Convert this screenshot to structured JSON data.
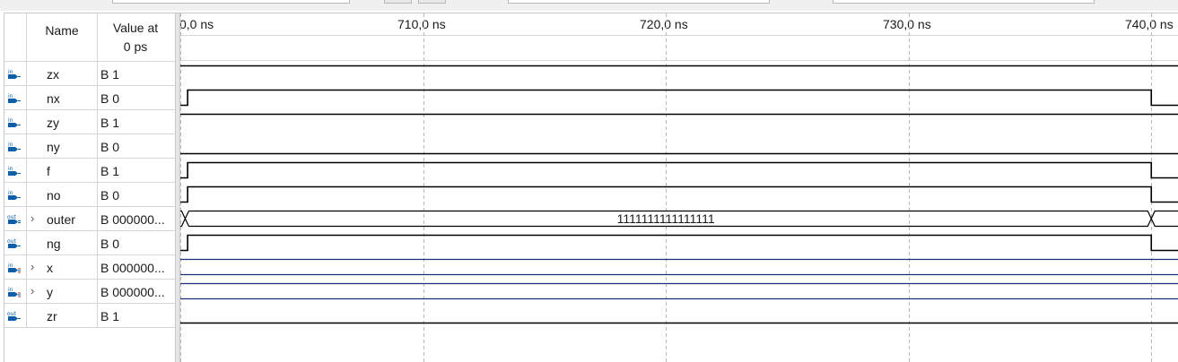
{
  "header": {
    "name_label": "Name",
    "value_label_line1": "Value at",
    "value_label_line2": "0 ps"
  },
  "signals": [
    {
      "name": "zx",
      "direction": "in",
      "value": "B 1",
      "expandable": false,
      "pin_icon": "input-pin-icon"
    },
    {
      "name": "nx",
      "direction": "in",
      "value": "B 0",
      "expandable": false,
      "pin_icon": "input-pin-icon"
    },
    {
      "name": "zy",
      "direction": "in",
      "value": "B 1",
      "expandable": false,
      "pin_icon": "input-pin-icon"
    },
    {
      "name": "ny",
      "direction": "in",
      "value": "B 0",
      "expandable": false,
      "pin_icon": "input-pin-icon"
    },
    {
      "name": "f",
      "direction": "in",
      "value": "B 1",
      "expandable": false,
      "pin_icon": "input-pin-icon"
    },
    {
      "name": "no",
      "direction": "in",
      "value": "B 0",
      "expandable": false,
      "pin_icon": "input-pin-icon"
    },
    {
      "name": "outer",
      "direction": "out",
      "value": "B 000000...",
      "expandable": true,
      "pin_icon": "output-bus-icon"
    },
    {
      "name": "ng",
      "direction": "out",
      "value": "B 0",
      "expandable": false,
      "pin_icon": "output-pin-icon"
    },
    {
      "name": "x",
      "direction": "in",
      "value": "B 000000...",
      "expandable": true,
      "pin_icon": "input-bus-icon"
    },
    {
      "name": "y",
      "direction": "in",
      "value": "B 000000...",
      "expandable": true,
      "pin_icon": "input-bus-icon"
    },
    {
      "name": "zr",
      "direction": "out",
      "value": "B 1",
      "expandable": false,
      "pin_icon": "output-pin-icon"
    }
  ],
  "timeline": {
    "ticks": [
      "0,0 ns",
      "710,0 ns",
      "720,0 ns",
      "730,0 ns",
      "740,0 ns"
    ],
    "tick_times_ns": [
      700,
      710,
      720,
      730,
      740
    ],
    "visible_start_ns": 700,
    "visible_end_ns": 741.1
  },
  "waveforms": [
    {
      "signal": "zx",
      "type": "bit",
      "segments": [
        {
          "from": 700,
          "to": 741.1,
          "level": 1
        }
      ]
    },
    {
      "signal": "nx",
      "type": "bit",
      "segments": [
        {
          "from": 700,
          "to": 700.3,
          "level": 0
        },
        {
          "from": 700.3,
          "to": 740,
          "level": 1
        },
        {
          "from": 740,
          "to": 741.1,
          "level": 0
        }
      ]
    },
    {
      "signal": "zy",
      "type": "bit",
      "segments": [
        {
          "from": 700,
          "to": 741.1,
          "level": 1
        }
      ]
    },
    {
      "signal": "ny",
      "type": "bit",
      "segments": [
        {
          "from": 700,
          "to": 741.1,
          "level": 0
        }
      ]
    },
    {
      "signal": "f",
      "type": "bit",
      "segments": [
        {
          "from": 700,
          "to": 700.3,
          "level": 0
        },
        {
          "from": 700.3,
          "to": 740,
          "level": 1
        },
        {
          "from": 740,
          "to": 741.1,
          "level": 0
        }
      ]
    },
    {
      "signal": "no",
      "type": "bit",
      "segments": [
        {
          "from": 700,
          "to": 700.3,
          "level": 0
        },
        {
          "from": 700.3,
          "to": 740,
          "level": 1
        },
        {
          "from": 740,
          "to": 741.1,
          "level": 0
        }
      ]
    },
    {
      "signal": "outer",
      "type": "bus",
      "transitions_ns": [
        700.2,
        740
      ],
      "label": "1111111111111111",
      "label_at_ns": 720
    },
    {
      "signal": "ng",
      "type": "bit",
      "segments": [
        {
          "from": 700,
          "to": 700.3,
          "level": 0
        },
        {
          "from": 700.3,
          "to": 740,
          "level": 1
        },
        {
          "from": 740,
          "to": 741.1,
          "level": 0
        }
      ]
    },
    {
      "signal": "x",
      "type": "bus-flat",
      "label": ""
    },
    {
      "signal": "y",
      "type": "bus-flat",
      "label": ""
    },
    {
      "signal": "zr",
      "type": "bit",
      "segments": [
        {
          "from": 700,
          "to": 741.1,
          "level": 0
        }
      ]
    }
  ],
  "colors": {
    "wave": "#000000",
    "bus_line": "#1c2f73",
    "grid": "#b9b9b9",
    "pin_blue": "#0a5fa8",
    "pin_red": "#c23b22"
  }
}
